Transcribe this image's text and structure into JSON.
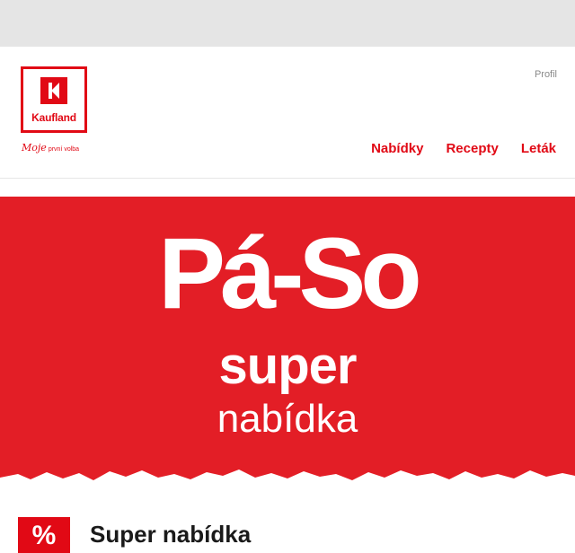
{
  "header": {
    "logo_text": "Kaufland",
    "tagline_script": "Moje",
    "tagline_small": "první volba",
    "profile_link": "Profil",
    "nav": [
      "Nabídky",
      "Recepty",
      "Leták"
    ]
  },
  "hero": {
    "title": "Pá-So",
    "line1": "super",
    "line2": "nabídka"
  },
  "section": {
    "badge_symbol": "%",
    "title": "Super nabídka"
  },
  "colors": {
    "brand_red": "#e10915",
    "hero_red": "#e31e26",
    "top_strip": "#e5e5e5"
  }
}
